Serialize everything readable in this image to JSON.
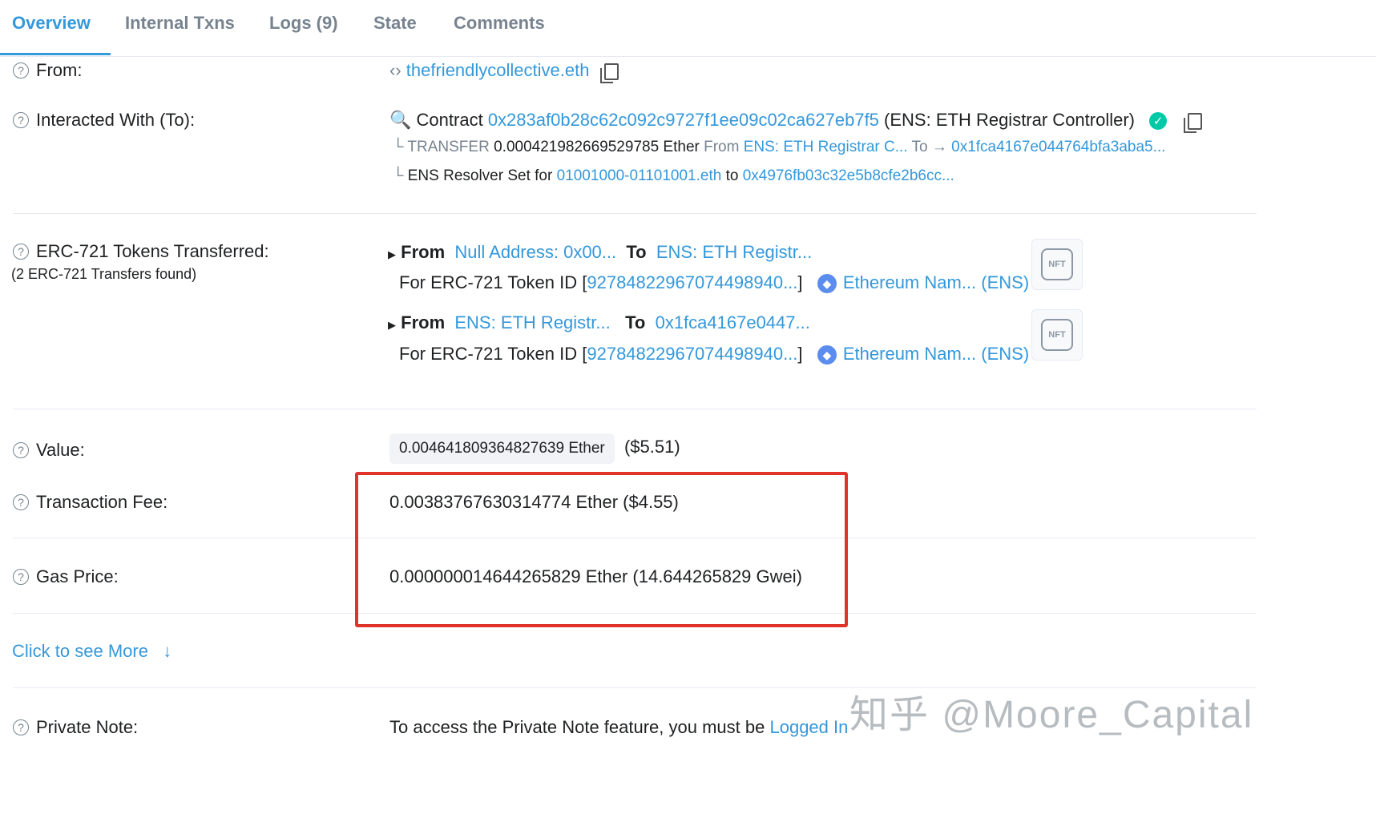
{
  "tabs": [
    "Overview",
    "Internal Txns",
    "Logs (9)",
    "State",
    "Comments"
  ],
  "from": {
    "label": "From:",
    "value": "thefriendlycollective.eth"
  },
  "to": {
    "label": "Interacted With (To):",
    "prefix": "Contract",
    "address": "0x283af0b28c62c092c9727f1ee09c02ca627eb7f5",
    "name": "(ENS: ETH Registrar Controller)",
    "transfer_tag": "TRANSFER",
    "transfer_amount": "0.000421982669529785 Ether",
    "transfer_from_word": "From",
    "transfer_from": "ENS: ETH Registrar C...",
    "transfer_to_word": "To",
    "transfer_to": "0x1fca4167e044764bfa3aba5...",
    "resolver_prefix": "ENS Resolver Set for",
    "resolver_name": "01001000-01101001.eth",
    "resolver_to_word": "to",
    "resolver_address": "0x4976fb03c32e5b8cfe2b6cc..."
  },
  "erc721": {
    "label": "ERC-721 Tokens Transferred:",
    "sub": "(2 ERC-721 Transfers found)",
    "transfers": [
      {
        "from_word": "From",
        "from": "Null Address: 0x00...",
        "to_word": "To",
        "to": "ENS: ETH Registr...",
        "for_label": "For ERC-721 Token ID [",
        "token_id": "92784822967074498940...",
        "close": "]",
        "token_name": "Ethereum Nam... (ENS)",
        "nft": "NFT"
      },
      {
        "from_word": "From",
        "from": "ENS: ETH Registr...",
        "to_word": "To",
        "to": "0x1fca4167e0447...",
        "for_label": "For ERC-721 Token ID [",
        "token_id": "92784822967074498940...",
        "close": "]",
        "token_name": "Ethereum Nam... (ENS)",
        "nft": "NFT"
      }
    ]
  },
  "value": {
    "label": "Value:",
    "amount": "0.004641809364827639 Ether",
    "usd": "($5.51)"
  },
  "fee": {
    "label": "Transaction Fee:",
    "value": "0.00383767630314774 Ether ($4.55)"
  },
  "gas": {
    "label": "Gas Price:",
    "value": "0.000000014644265829 Ether (14.644265829 Gwei)"
  },
  "more": {
    "label": "Click to see More"
  },
  "note": {
    "label": "Private Note:",
    "text": "To access the Private Note feature, you must be",
    "link": "Logged In"
  },
  "watermark": "知乎 @Moore_Capital",
  "colors": {
    "link": "#3498db",
    "highlight_box": "#e0332a",
    "verified": "#00c9a7"
  }
}
